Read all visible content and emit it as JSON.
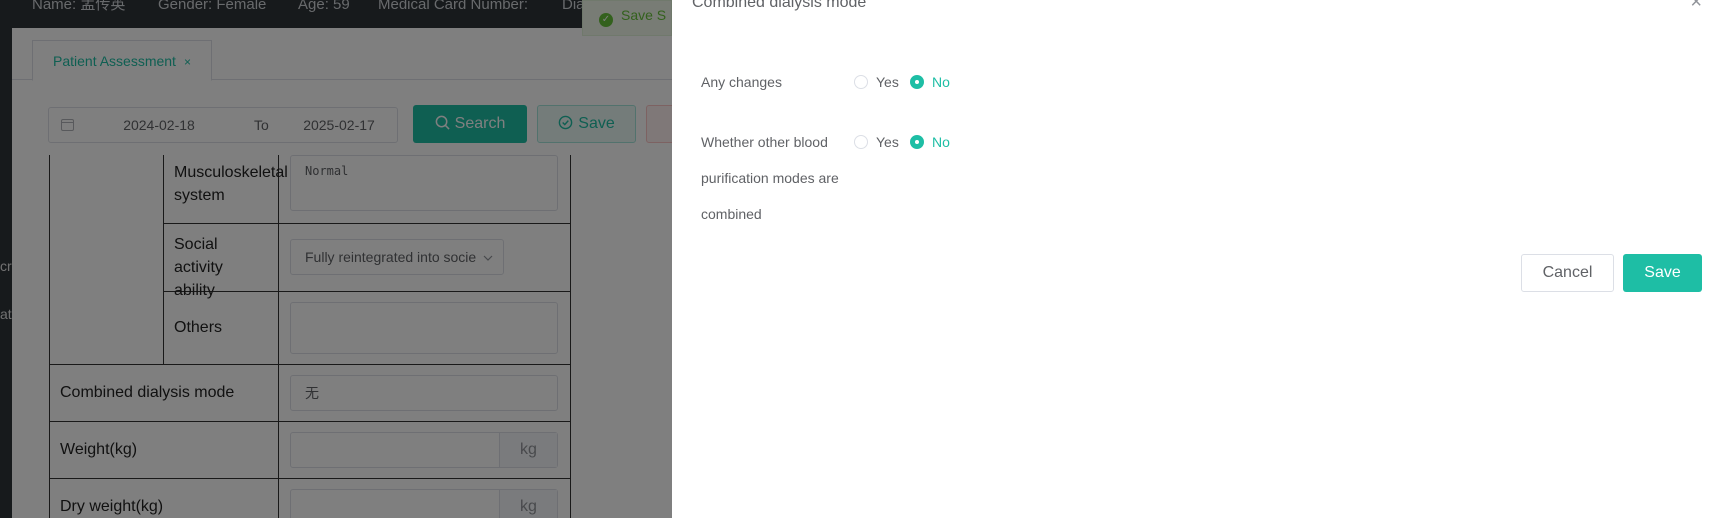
{
  "header": {
    "name": "Name: 孟传英",
    "gender": "Gender: Female",
    "age": "Age: 59",
    "medical_card": "Medical Card Number:",
    "dia": "Dia"
  },
  "side_rail": {
    "item1": "cr",
    "item2": "at"
  },
  "toast": {
    "text": "Save S"
  },
  "tabs": [
    {
      "label": "Patient Assessment",
      "close": "×"
    }
  ],
  "date_range": {
    "start": "2024-02-18",
    "separator": "To",
    "end": "2025-02-17"
  },
  "toolbar": {
    "search_label": "Search",
    "save_label": "Save"
  },
  "form": {
    "musculoskeletal": {
      "label": "Musculoskeletal system",
      "value": "Normal"
    },
    "social": {
      "label": "Social activity ability",
      "value": "Fully reintegrated into socie"
    },
    "others": {
      "label": "Others",
      "value": ""
    },
    "combined": {
      "label": "Combined dialysis mode",
      "value": "无"
    },
    "weight": {
      "label": "Weight(kg)",
      "unit": "kg"
    },
    "dry_weight": {
      "label": "Dry weight(kg)",
      "unit": "kg"
    }
  },
  "drawer": {
    "title": "Combined dialysis mode",
    "close": "×",
    "q1": {
      "label": "Any changes",
      "yes": "Yes",
      "no": "No",
      "selected": "No"
    },
    "q2": {
      "label_line1": "Whether other blood",
      "label_line2": "purification modes are",
      "label_line3": "combined",
      "yes": "Yes",
      "no": "No",
      "selected": "No"
    },
    "cancel_label": "Cancel",
    "save_label": "Save"
  },
  "colors": {
    "accent": "#1ebea5",
    "sidebar": "#2f3439"
  }
}
